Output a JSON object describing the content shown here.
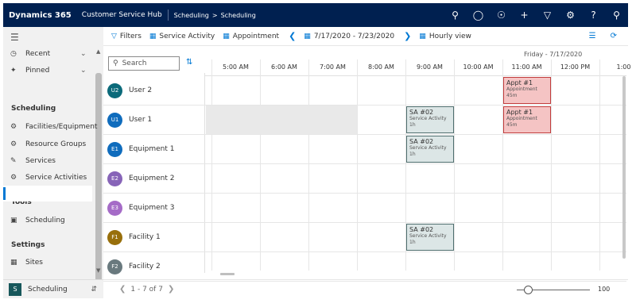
{
  "topbar": {
    "brand": "Dynamics 365",
    "app": "Customer Service Hub",
    "breadcrumb": [
      "Scheduling",
      "Scheduling"
    ],
    "icons": [
      "search-icon",
      "task-icon",
      "lightbulb-icon",
      "plus-icon",
      "filter-icon",
      "gear-icon",
      "help-icon",
      "user-icon"
    ]
  },
  "sidebar": {
    "recent": "Recent",
    "pinned": "Pinned",
    "sections": {
      "scheduling": "Scheduling",
      "tools": "Tools",
      "settings": "Settings"
    },
    "scheduling_items": [
      "Facilities/Equipment",
      "Resource Groups",
      "Services",
      "Service Activities"
    ],
    "tools_items": [
      "Scheduling"
    ],
    "settings_items": [
      "Sites"
    ],
    "area": {
      "badge": "S",
      "label": "Scheduling"
    }
  },
  "toolbar": {
    "filters": "Filters",
    "service_activity": "Service Activity",
    "appointment": "Appointment",
    "date_range": "7/17/2020 - 7/23/2020",
    "view": "Hourly view"
  },
  "search": {
    "placeholder": "Search"
  },
  "resources": [
    {
      "initials": "U2",
      "name": "User 2",
      "color": "#0b6a7a"
    },
    {
      "initials": "U1",
      "name": "User 1",
      "color": "#0f6cbd"
    },
    {
      "initials": "E1",
      "name": "Equipment 1",
      "color": "#0f6cbd"
    },
    {
      "initials": "E2",
      "name": "Equipment 2",
      "color": "#8764b8"
    },
    {
      "initials": "E3",
      "name": "Equipment 3",
      "color": "#a56bc7"
    },
    {
      "initials": "F1",
      "name": "Facility 1",
      "color": "#986f0b"
    },
    {
      "initials": "F2",
      "name": "Facility 2",
      "color": "#69797e"
    }
  ],
  "calendar": {
    "date_label": "Friday - 7/17/2020",
    "hours": [
      "5:00 AM",
      "6:00 AM",
      "7:00 AM",
      "8:00 AM",
      "9:00 AM",
      "10:00 AM",
      "11:00 AM",
      "12:00 PM",
      "1:00"
    ],
    "events": [
      {
        "title": "Appt #1",
        "type": "Appointment",
        "duration": "45m",
        "kind": "ap",
        "resource": "User 2",
        "start": "11:00 AM"
      },
      {
        "title": "SA #02",
        "type": "Service Activity",
        "duration": "1h",
        "kind": "sa",
        "resource": "User 1",
        "start": "9:00 AM"
      },
      {
        "title": "Appt #1",
        "type": "Appointment",
        "duration": "45m",
        "kind": "ap",
        "resource": "User 1",
        "start": "11:00 AM"
      },
      {
        "title": "SA #02",
        "type": "Service Activity",
        "duration": "1h",
        "kind": "sa",
        "resource": "Equipment 1",
        "start": "9:00 AM"
      },
      {
        "title": "SA #02",
        "type": "Service Activity",
        "duration": "1h",
        "kind": "sa",
        "resource": "Facility 1",
        "start": "9:00 AM"
      }
    ]
  },
  "footer": {
    "paging": "1 - 7 of 7",
    "zoom": "100"
  }
}
